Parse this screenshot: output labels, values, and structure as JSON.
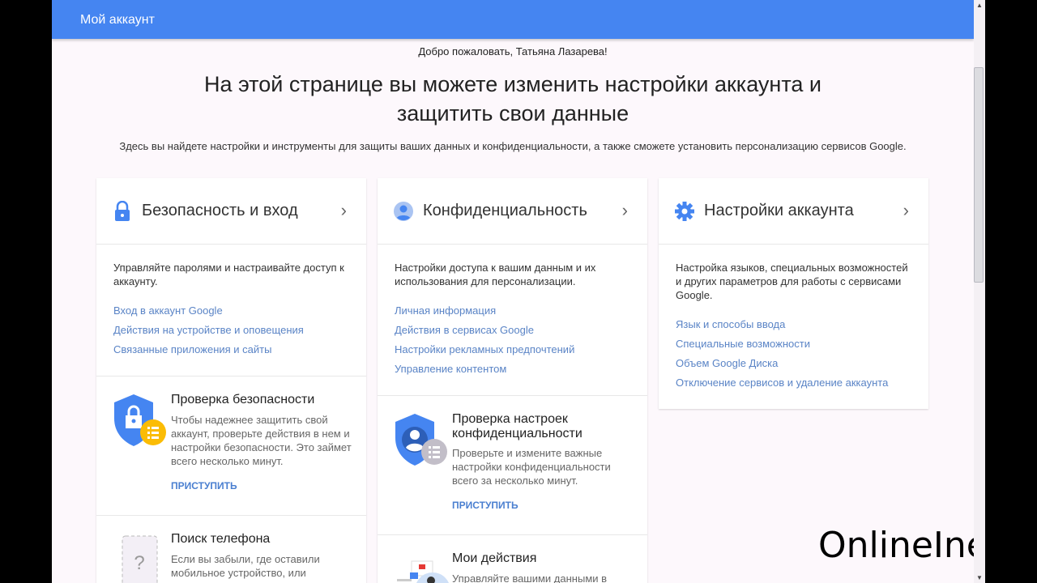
{
  "header": {
    "title": "Мой аккаунт"
  },
  "welcome": "Добро пожаловать, Татьяна Лазарева!",
  "headline_line1": "На этой странице вы можете изменить настройки аккаунта и",
  "headline_line2": "защитить свои данные",
  "subtitle": "Здесь вы найдете настройки и инструменты для защиты ваших данных и конфиденциальности, а также сможете установить персонализацию сервисов Google.",
  "cards": [
    {
      "title": "Безопасность и вход",
      "icon": "lock-icon",
      "desc": "Управляйте паролями и настраивайте доступ к аккаунту.",
      "links": [
        "Вход в аккаунт Google",
        "Действия на устройстве и оповещения",
        "Связанные приложения и сайты"
      ],
      "sections": [
        {
          "title": "Проверка безопасности",
          "desc": "Чтобы надежнее защитить свой аккаунт, проверьте действия в нем и настройки безопасности. Это займет всего несколько минут.",
          "action": "ПРИСТУПИТЬ"
        },
        {
          "title": "Поиск телефона",
          "desc": "Если вы забыли, где оставили мобильное устройство, или"
        }
      ]
    },
    {
      "title": "Конфиденциальность",
      "icon": "person-icon",
      "desc": "Настройки доступа к вашим данным и их использования для персонализации.",
      "links": [
        "Личная информация",
        "Действия в сервисах Google",
        "Настройки рекламных предпочтений",
        "Управление контентом"
      ],
      "sections": [
        {
          "title": "Проверка настроек конфиденциальности",
          "desc": "Проверьте и измените важные настройки конфиденциальности всего за несколько минут.",
          "action": "ПРИСТУПИТЬ"
        },
        {
          "title": "Мои действия",
          "desc": "Управляйте вашими данными в"
        }
      ]
    },
    {
      "title": "Настройки аккаунта",
      "icon": "gear-icon",
      "desc": "Настройка языков, специальных возможностей и других параметров для работы с сервисами Google.",
      "links": [
        "Язык и способы ввода",
        "Специальные возможности",
        "Объем Google Диска",
        "Отключение сервисов и удаление аккаунта"
      ]
    }
  ],
  "watermark": "OnlineInet",
  "colors": {
    "accent": "#4585f1",
    "link": "#5a84c6"
  }
}
